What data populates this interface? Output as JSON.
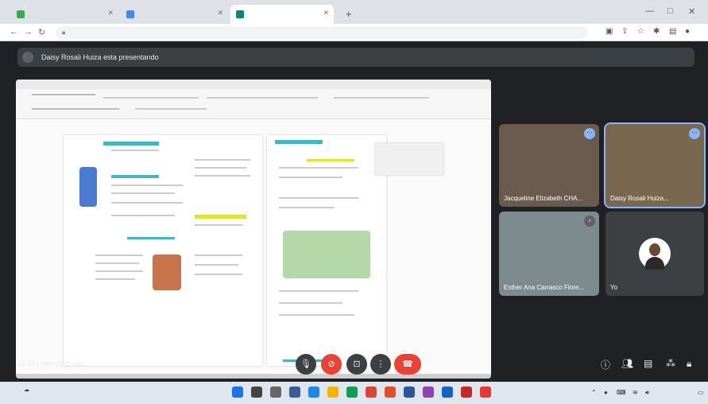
{
  "meet": {
    "presenting_banner": "Daisy Rosali Huiza esta presentando",
    "meeting_time": "11:24",
    "meeting_code": "nun-ygyb-aya",
    "participants": [
      {
        "name": "Jacqueline Elizabeth CHA..."
      },
      {
        "name": "Daisy Rosali Huiza..."
      },
      {
        "name": "Esther Ana Carrasco Flore..."
      },
      {
        "name": "Yo"
      }
    ]
  },
  "colors": {
    "meet_bg": "#202124",
    "tile_bg": "#3c4043",
    "accent": "#8ab4f8",
    "danger": "#ea4335"
  },
  "icons": {
    "mic": "microphone-icon",
    "camera": "camera-off-icon",
    "present": "present-screen-icon",
    "more": "more-options-icon",
    "hangup": "hang-up-icon",
    "info": "info-icon",
    "people": "people-icon",
    "chat": "chat-icon",
    "activities": "activities-icon",
    "host": "host-controls-icon"
  }
}
